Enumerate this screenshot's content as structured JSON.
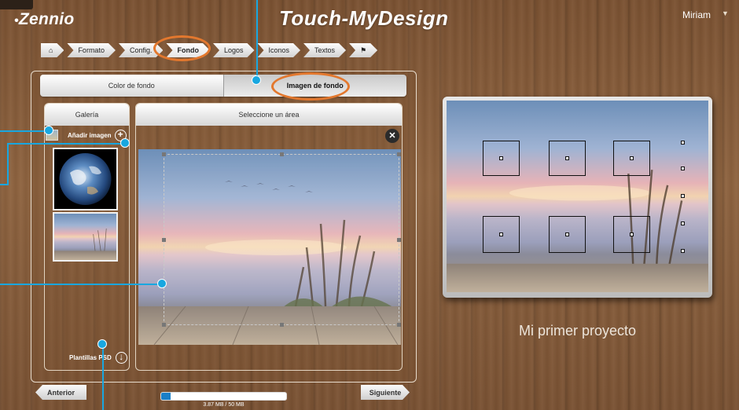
{
  "header": {
    "logo": "Zennio",
    "title": "Touch-MyDesign",
    "user": "Miriam"
  },
  "breadcrumb": [
    "Formato",
    "Config.",
    "Fondo",
    "Logos",
    "Iconos",
    "Textos"
  ],
  "breadcrumb_active": "Fondo",
  "toggle": {
    "color_label": "Color de fondo",
    "image_label": "Imagen de fondo",
    "selected": "Imagen de fondo"
  },
  "gallery": {
    "title": "Galería",
    "add_label": "Añadir imagen",
    "psd_label": "Plantillas PSD"
  },
  "selector": {
    "title": "Seleccione un área"
  },
  "navigation": {
    "prev_label": "Anterior",
    "next_label": "Siguiente"
  },
  "storage": {
    "used_mb": 3.87,
    "total_mb": 50,
    "label": "3.87 MB / 50 MB"
  },
  "preview": {
    "project_name": "Mi primer proyecto"
  },
  "colors": {
    "accent_blue": "#18a7e0",
    "highlight_orange": "#e3782e"
  },
  "icons": [
    "home-icon",
    "flag-icon",
    "chevron-down-icon",
    "image-icon",
    "plus-circle-icon",
    "close-icon",
    "download-circle-icon"
  ]
}
